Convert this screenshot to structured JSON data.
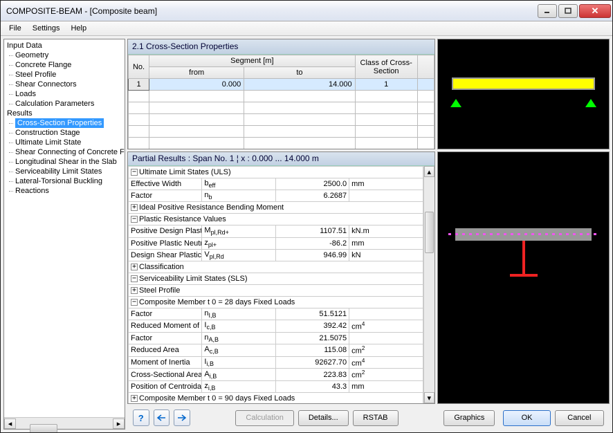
{
  "window": {
    "title": "COMPOSITE-BEAM - [Composite beam]"
  },
  "menu": {
    "file": "File",
    "settings": "Settings",
    "help": "Help"
  },
  "tree": {
    "input": "Input Data",
    "geometry": "Geometry",
    "concrete": "Concrete Flange",
    "steel": "Steel Profile",
    "shearconn": "Shear Connectors",
    "loads": "Loads",
    "calcparams": "Calculation Parameters",
    "results": "Results",
    "csprops": "Cross-Section Properties",
    "construction": "Construction Stage",
    "uls": "Ultimate Limit State",
    "shearcon": "Shear Connecting of Concrete Flange",
    "longshear": "Longitudinal Shear in the Slab",
    "sls": "Serviceability Limit States",
    "ltb": "Lateral-Torsional Buckling",
    "reactions": "Reactions"
  },
  "props": {
    "title": "2.1 Cross-Section Properties",
    "h_no": "No.",
    "h_seg": "Segment [m]",
    "h_from": "from",
    "h_to": "to",
    "h_class": "Class of Cross-Section",
    "row": {
      "no": "1",
      "from": "0.000",
      "to": "14.000",
      "class": "1"
    }
  },
  "partial": {
    "title": "Partial Results :     Span No. 1  ¦ x : 0.000 ... 14.000 m",
    "uls": "Ultimate Limit States (ULS)",
    "eff_width": "Effective Width",
    "beff": "b eff",
    "beff_v": "2500.0",
    "mm": "mm",
    "factor": "Factor",
    "nb": "n b",
    "nb_v": "6.2687",
    "idealpos": "Ideal Positive Resistance Bending Moment",
    "plastic": "Plastic Resistance Values",
    "mplrd": "Positive Design Plastic Resistance Moment",
    "mplrd_s": "M pl,Rd+",
    "mplrd_v": "1107.51",
    "knm": "kN.m",
    "zpl": "Positive Plastic Neutral Axis",
    "zpl_s": "z pl+",
    "zpl_v": "-86.2",
    "vplrd": "Design Shear Plastic Resistance",
    "vplrd_s": "V pl,Rd",
    "vplrd_v": "946.99",
    "kn": "kN",
    "classif": "Classification",
    "sls": "Serviceability Limit States (SLS)",
    "steelprof": "Steel Profile",
    "comp28": "Composite Member t 0 = 28 days  Fixed Loads",
    "nib": "n I,B",
    "nib_v": "51.5121",
    "redmi": "Reduced Moment of Inertia",
    "icb": "I c,B",
    "icb_v": "392.42",
    "cm4": "cm 4",
    "nab": "n A,B",
    "nab_v": "21.5075",
    "redarea": "Reduced Area",
    "acb": "A c,B",
    "acb_v": "115.08",
    "cm2": "cm 2",
    "mi": "Moment of Inertia",
    "iib": "I i,B",
    "iib_v": "92627.70",
    "csa": "Cross-Sectional Area",
    "aib": "A i,B",
    "aib_v": "223.83",
    "pca": "Position of Centroidal Axis",
    "zib": "z i,B",
    "zib_v": "43.3",
    "comp90": "Composite Member t 0 = 90 days  Fixed Loads"
  },
  "buttons": {
    "calc": "Calculation",
    "details": "Details...",
    "rstab": "RSTAB",
    "graphics": "Graphics",
    "ok": "OK",
    "cancel": "Cancel"
  }
}
